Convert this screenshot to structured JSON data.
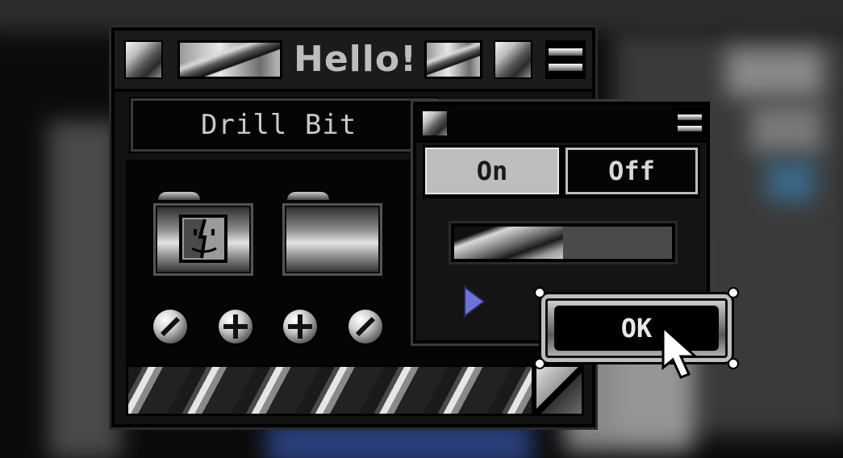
{
  "main_window": {
    "title": "Hello!",
    "label_field": "Drill Bit"
  },
  "sub_window": {
    "toggle_on_label": "On",
    "toggle_off_label": "Off",
    "progress_fraction": 0.5,
    "ok_button_label": "OK"
  },
  "icons": {
    "close": "close-box-icon",
    "zoom": "zoom-box-icon",
    "collapse": "collapse-box-icon",
    "finder_folder": "finder-folder-icon",
    "folder": "folder-icon",
    "screws": [
      "flat-screw-icon",
      "phillips-screw-icon",
      "phillips-screw-icon",
      "flat-screw-icon"
    ],
    "resize": "resize-grip-icon",
    "disclosure": "disclosure-triangle-icon",
    "cursor": "arrow-cursor-icon"
  },
  "colors": {
    "chrome_dark": "#000000",
    "toggle_selected": "#bdbdbd",
    "disclosure_triangle": "#6f73d9"
  }
}
